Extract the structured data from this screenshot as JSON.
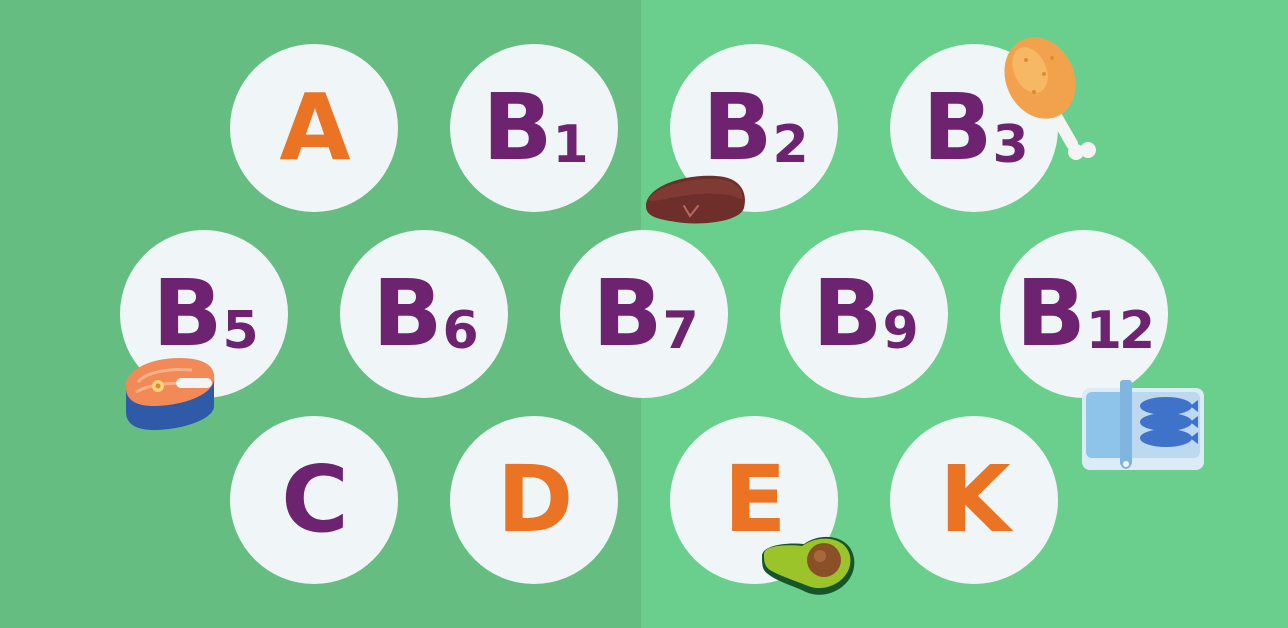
{
  "colors": {
    "background_left": "#66bd82",
    "background_right": "#6acf8c",
    "badge_fill": "#f0f6f8",
    "purple": "#6e2370",
    "orange": "#ea7424"
  },
  "vitamins": [
    {
      "letter": "A",
      "sub": "",
      "color": "#ea7424"
    },
    {
      "letter": "B",
      "sub": "1",
      "color": "#6e2370"
    },
    {
      "letter": "B",
      "sub": "2",
      "color": "#6e2370"
    },
    {
      "letter": "B",
      "sub": "3",
      "color": "#6e2370"
    },
    {
      "letter": "B",
      "sub": "5",
      "color": "#6e2370"
    },
    {
      "letter": "B",
      "sub": "6",
      "color": "#6e2370"
    },
    {
      "letter": "B",
      "sub": "7",
      "color": "#6e2370"
    },
    {
      "letter": "B",
      "sub": "9",
      "color": "#6e2370"
    },
    {
      "letter": "B",
      "sub": "12",
      "color": "#6e2370"
    },
    {
      "letter": "C",
      "sub": "",
      "color": "#6e2370"
    },
    {
      "letter": "D",
      "sub": "",
      "color": "#ea7424"
    },
    {
      "letter": "E",
      "sub": "",
      "color": "#ea7424"
    },
    {
      "letter": "K",
      "sub": "",
      "color": "#ea7424"
    }
  ],
  "foods": [
    "chicken-drumstick-icon",
    "liver-icon",
    "salmon-steak-icon",
    "sardine-can-icon",
    "avocado-icon"
  ]
}
